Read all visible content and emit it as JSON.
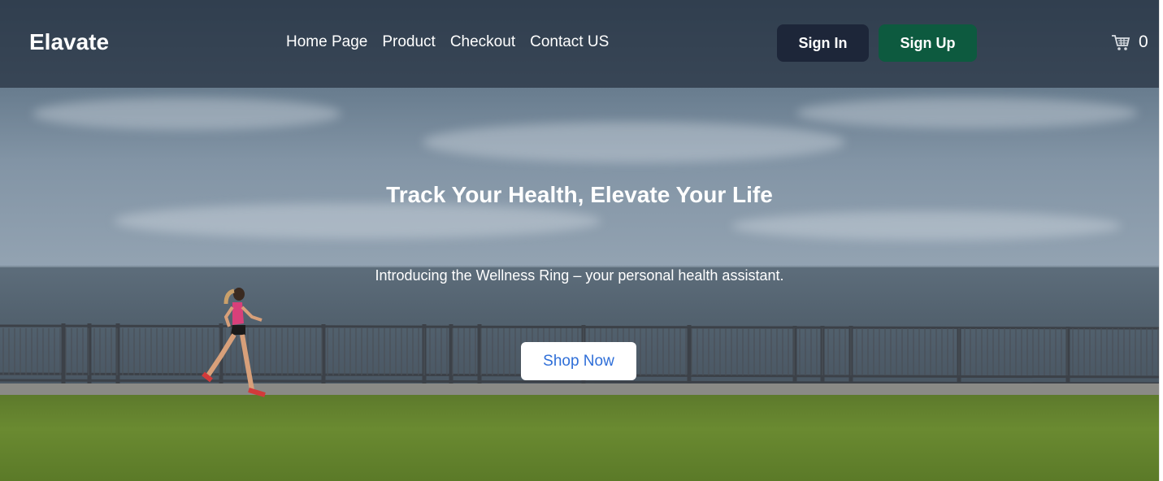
{
  "header": {
    "logo": "Elavate",
    "nav": [
      "Home Page",
      "Product",
      "Checkout",
      "Contact US"
    ],
    "sign_in_label": "Sign In",
    "sign_up_label": "Sign Up",
    "cart_count": "0",
    "cart_icon": "shopping-cart-icon"
  },
  "hero": {
    "title": "Track Your Health, Elevate Your Life",
    "subtitle": "Introducing the Wellness Ring – your personal health assistant.",
    "cta_label": "Shop Now"
  },
  "colors": {
    "header_bg": "#263040",
    "sign_in_bg": "#1d2639",
    "sign_up_bg": "#0d5a3f",
    "cta_text": "#2f6fd8"
  }
}
